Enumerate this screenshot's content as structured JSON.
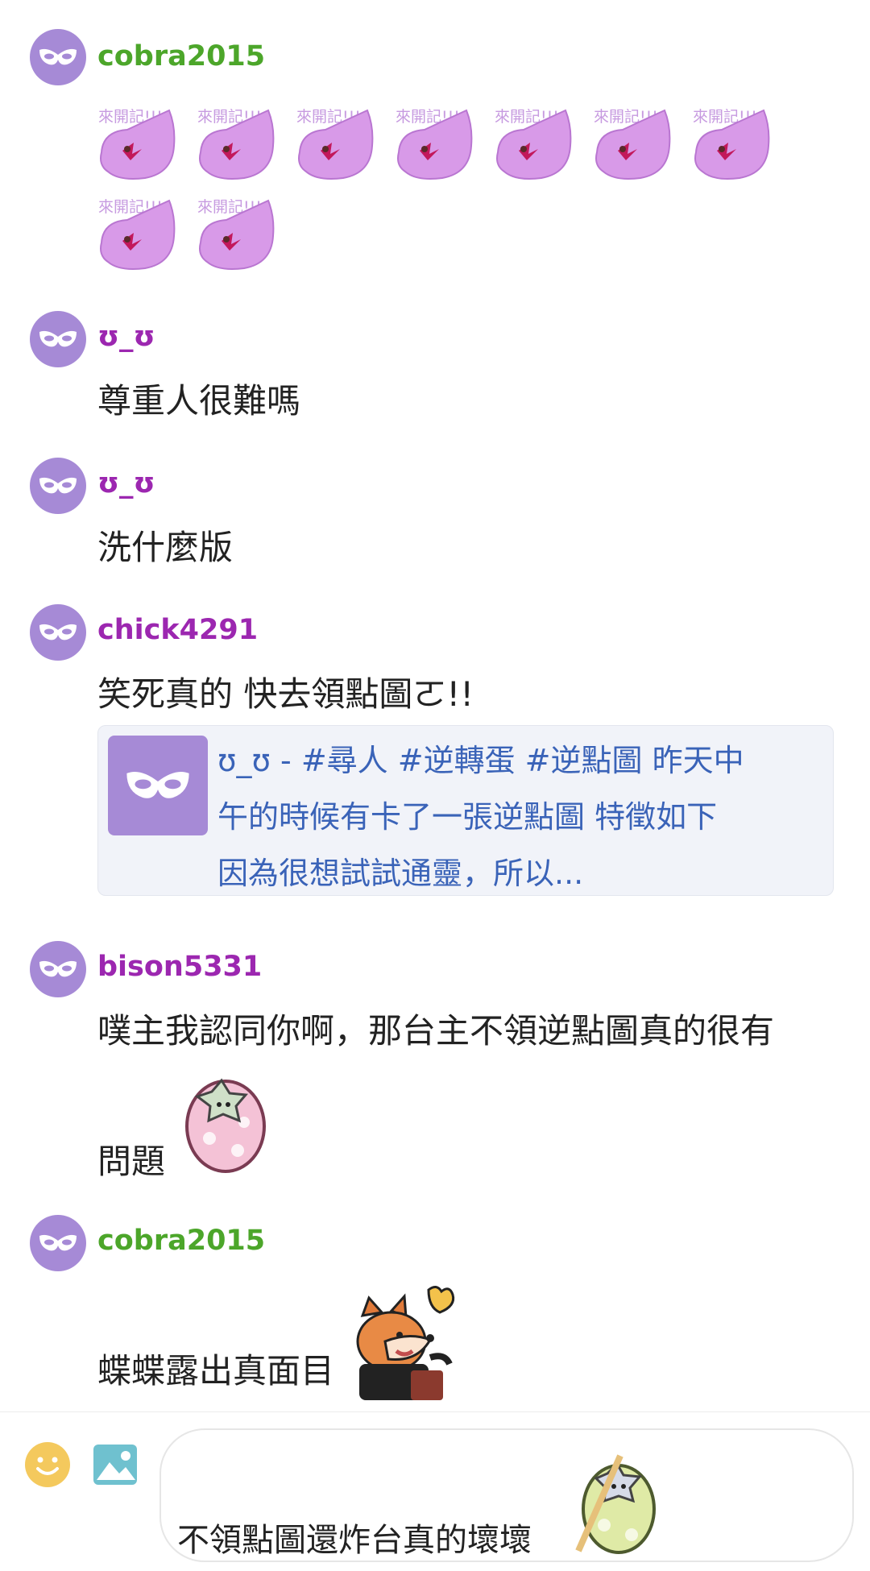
{
  "colors": {
    "avatar_bg": "#a68ad6",
    "name_green": "#4ca62a",
    "name_purple": "#9c27b0",
    "link_blue": "#3a63b8",
    "card_bg": "#f1f3f9"
  },
  "messages": [
    {
      "author": "cobra2015",
      "author_color": "green",
      "type": "stickers",
      "sticker_label": "來開記!!!",
      "sticker_count": 9
    },
    {
      "author": "ʊ_ʊ",
      "author_color": "purple",
      "text": "尊重人很難嗎"
    },
    {
      "author": "ʊ_ʊ",
      "author_color": "purple",
      "text": "洗什麼版"
    },
    {
      "author": "chick4291",
      "author_color": "purple",
      "text": "笑死真的 快去領點圖ㄛ!!",
      "link_card": {
        "lines": [
          "ʊ_ʊ - #尋人 #逆轉蛋 #逆點圖 昨天中",
          "午的時候有卡了一張逆點圖 特徵如下",
          "因為很想試試通靈，所以..."
        ]
      }
    },
    {
      "author": "bison5331",
      "author_color": "purple",
      "text_line1": "噗主我認同你啊，那台主不領逆點圖真的很有",
      "text_line2": "問題"
    },
    {
      "author": "cobra2015",
      "author_color": "green",
      "text": "蝶蝶露出真面目"
    }
  ],
  "composer": {
    "text": "不領點圖還炸台真的壞壞",
    "emoji_icon": "smiley-icon",
    "image_icon": "image-icon"
  }
}
